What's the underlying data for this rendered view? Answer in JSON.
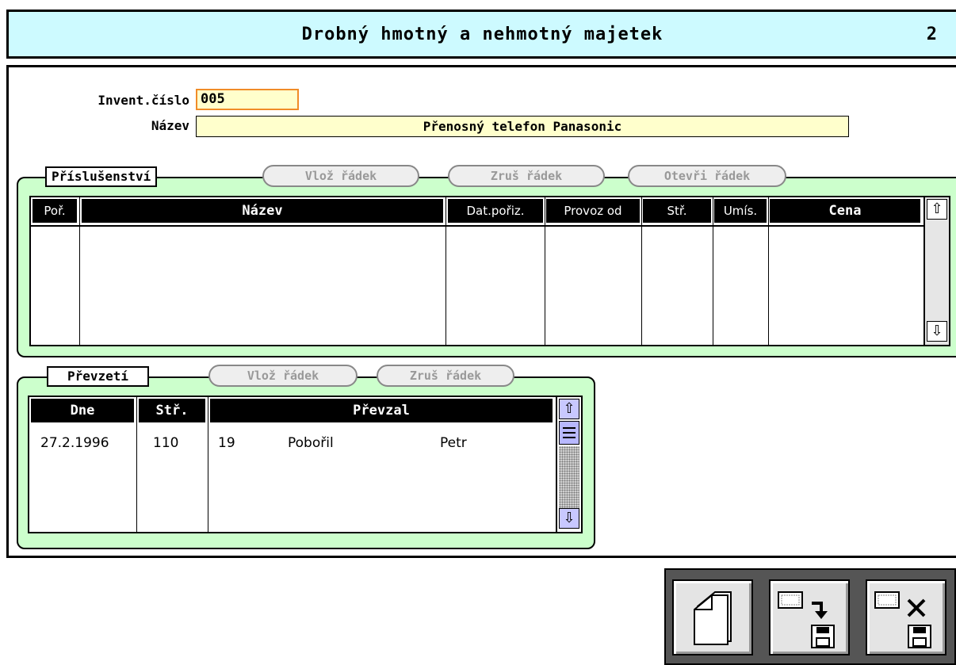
{
  "window": {
    "title": "Drobný hmotný a nehmotný majetek",
    "page_number": "2"
  },
  "form": {
    "inv_label": "Invent.číslo",
    "inv_value": "005",
    "name_label": "Název",
    "name_value": "Přenosný telefon Panasonic"
  },
  "accessories": {
    "tab_label": "Příslušenství",
    "buttons": {
      "insert": "Vlož řádek",
      "delete": "Zruš řádek",
      "open": "Otevři řádek"
    },
    "columns": [
      "Poř.",
      "Název",
      "Dat.pořiz.",
      "Provoz od",
      "Stř.",
      "Umís.",
      "Cena"
    ],
    "rows": []
  },
  "handover": {
    "tab_label": "Převzetí",
    "buttons": {
      "insert": "Vlož řádek",
      "delete": "Zruš řádek"
    },
    "columns": [
      "Dne",
      "Stř.",
      "Převzal"
    ],
    "rows": [
      {
        "date": "27.2.1996",
        "center": "110",
        "num": "19",
        "surname": "Pobořil",
        "firstname": "Petr"
      }
    ]
  },
  "toolbar": {
    "buttons": [
      {
        "icon": "new-document-icon"
      },
      {
        "icon": "save-record-icon"
      },
      {
        "icon": "delete-record-icon"
      }
    ]
  }
}
